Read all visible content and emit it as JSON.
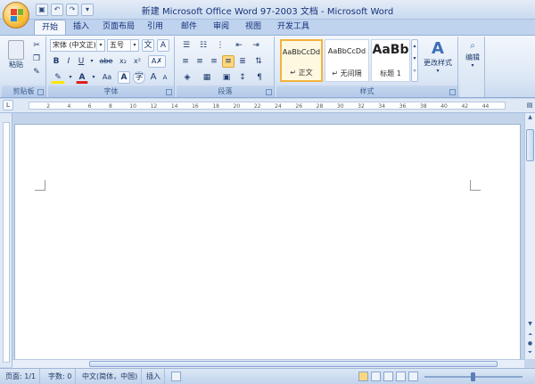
{
  "window": {
    "title": "新建 Microsoft Office Word 97-2003 文档 - Microsoft Word"
  },
  "qat": {
    "save_icon": "save-icon",
    "undo_icon": "undo-icon",
    "redo_icon": "redo-icon"
  },
  "tabs": [
    "开始",
    "插入",
    "页面布局",
    "引用",
    "邮件",
    "审阅",
    "视图",
    "开发工具"
  ],
  "clipboard": {
    "paste_label": "粘贴",
    "group_label": "剪贴板"
  },
  "font": {
    "name": "宋体 (中文正)",
    "size": "五号",
    "bold": "B",
    "italic": "I",
    "underline": "U",
    "strike": "abe",
    "subscript": "x₂",
    "superscript": "x²",
    "case": "Aa",
    "group_label": "字体"
  },
  "paragraph": {
    "group_label": "段落"
  },
  "styles": {
    "items": [
      {
        "preview": "AaBbCcDd",
        "name": "↵ 正文"
      },
      {
        "preview": "AaBbCcDd",
        "name": "↵ 无间隔"
      },
      {
        "preview": "AaBb",
        "name": "标题 1"
      }
    ],
    "change_label": "更改样式",
    "group_label": "样式"
  },
  "editing": {
    "label": "编辑"
  },
  "ruler": {
    "ticks": [
      "2",
      "4",
      "6",
      "8",
      "10",
      "12",
      "14",
      "16",
      "18",
      "20",
      "22",
      "24",
      "26",
      "28",
      "30",
      "32",
      "34",
      "36",
      "38",
      "40",
      "42",
      "44"
    ]
  },
  "status": {
    "page": "页面: 1/1",
    "words": "字数: 0",
    "language": "中文(简体，中国)",
    "mode": "插入"
  },
  "colors": {
    "accent": "#f2b33d",
    "ribbon": "#dce7f5",
    "text": "#1e395b"
  }
}
